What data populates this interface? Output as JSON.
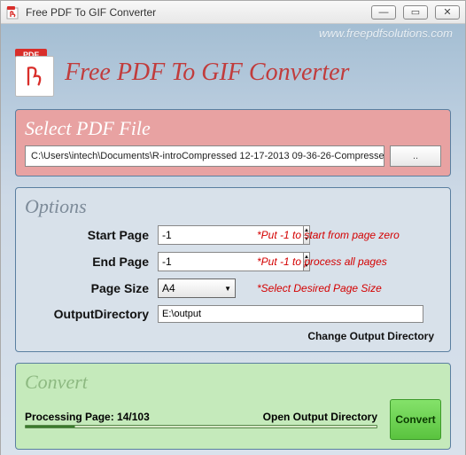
{
  "window": {
    "title": "Free PDF To GIF Converter",
    "watermark": "www.freepdfsolutions.com"
  },
  "banner": {
    "icon_badge": "PDF",
    "title": "Free PDF To GIF Converter"
  },
  "select_panel": {
    "title": "Select PDF File",
    "path": "C:\\Users\\intech\\Documents\\R-introCompressed 12-17-2013 09-36-26-Compresse",
    "browse_label": ".."
  },
  "options_panel": {
    "title": "Options",
    "start_page": {
      "label": "Start Page",
      "value": "-1",
      "hint": "*Put -1 to start from page zero"
    },
    "end_page": {
      "label": "End Page",
      "value": "-1",
      "hint": "*Put -1 to process all pages"
    },
    "page_size": {
      "label": "Page Size",
      "value": "A4",
      "hint": "*Select Desired Page Size"
    },
    "output_dir": {
      "label": "OutputDirectory",
      "value": "E:\\output"
    },
    "change_output_link": "Change Output Directory"
  },
  "convert_panel": {
    "title": "Convert",
    "status_prefix": "Processing Page: ",
    "status_count": "14/103",
    "open_output_link": "Open Output Directory",
    "convert_button": "Convert"
  }
}
